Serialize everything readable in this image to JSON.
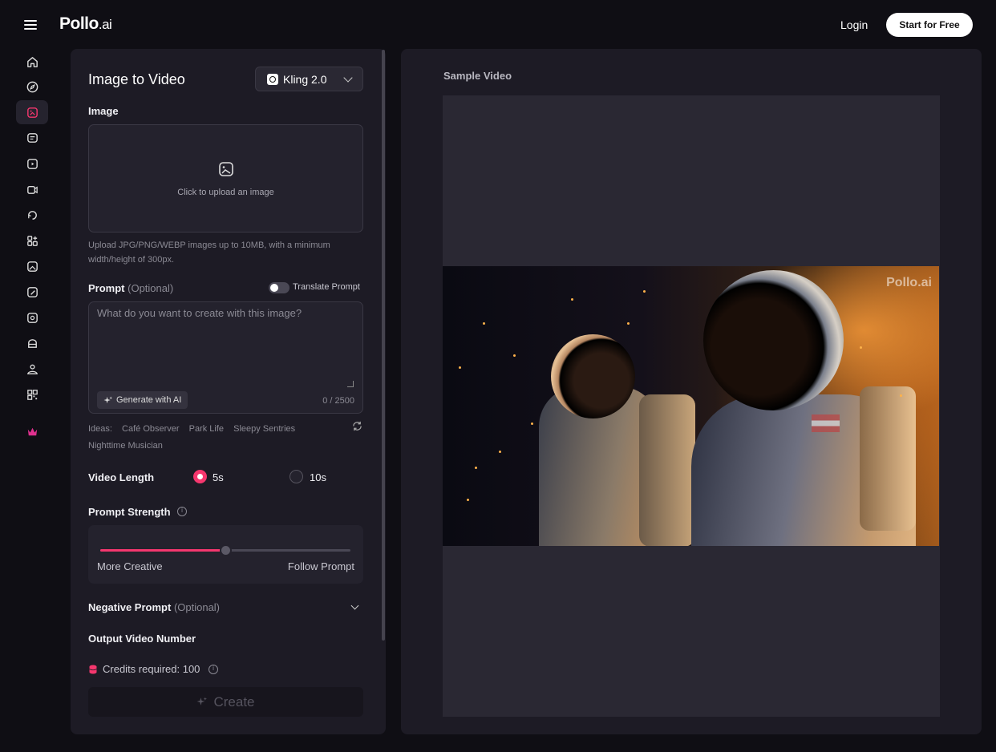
{
  "header": {
    "logo_main": "Pollo",
    "logo_suffix": ".ai",
    "login": "Login",
    "start": "Start for Free"
  },
  "sidebar": {
    "items": [
      {
        "icon": "home-icon"
      },
      {
        "icon": "compass-icon"
      },
      {
        "icon": "image-to-video-icon",
        "active": true
      },
      {
        "icon": "text-to-video-icon"
      },
      {
        "icon": "video-to-video-icon"
      },
      {
        "icon": "video-camera-icon"
      },
      {
        "icon": "refresh-video-icon"
      },
      {
        "icon": "apps-grid-icon"
      },
      {
        "icon": "image-ai-icon"
      },
      {
        "icon": "image-edit-icon"
      },
      {
        "icon": "image-effect-icon"
      },
      {
        "icon": "cake-icon"
      },
      {
        "icon": "avatar-icon"
      },
      {
        "icon": "qr-code-icon"
      },
      {
        "icon": "crown-icon",
        "color": "#e0308f"
      }
    ]
  },
  "panel": {
    "title": "Image to Video",
    "model": "Kling 2.0",
    "image_label": "Image",
    "upload_text": "Click to upload an image",
    "upload_hint": "Upload JPG/PNG/WEBP images up to 10MB, with a minimum width/height of 300px.",
    "prompt_label": "Prompt",
    "prompt_optional": "(Optional)",
    "translate_label": "Translate Prompt",
    "prompt_placeholder": "What do you want to create with this image?",
    "generate_ai": "Generate with AI",
    "counter": "0 / 2500",
    "ideas_label": "Ideas:",
    "ideas": [
      "Café Observer",
      "Park Life",
      "Sleepy Sentries",
      "Nighttime Musician"
    ],
    "video_length_label": "Video Length",
    "length_options": [
      {
        "label": "5s",
        "selected": true
      },
      {
        "label": "10s",
        "selected": false
      }
    ],
    "prompt_strength_label": "Prompt Strength",
    "strength_value": 0.5,
    "strength_left": "More Creative",
    "strength_right": "Follow Prompt",
    "negative_label": "Negative Prompt",
    "negative_optional": "(Optional)",
    "output_label": "Output Video Number",
    "credits": "Credits required: 100",
    "create": "Create"
  },
  "preview": {
    "label": "Sample Video",
    "watermark": "Pollo.ai"
  },
  "colors": {
    "accent": "#f5376e",
    "background": "#0f0e14",
    "panel": "#1d1b25"
  }
}
